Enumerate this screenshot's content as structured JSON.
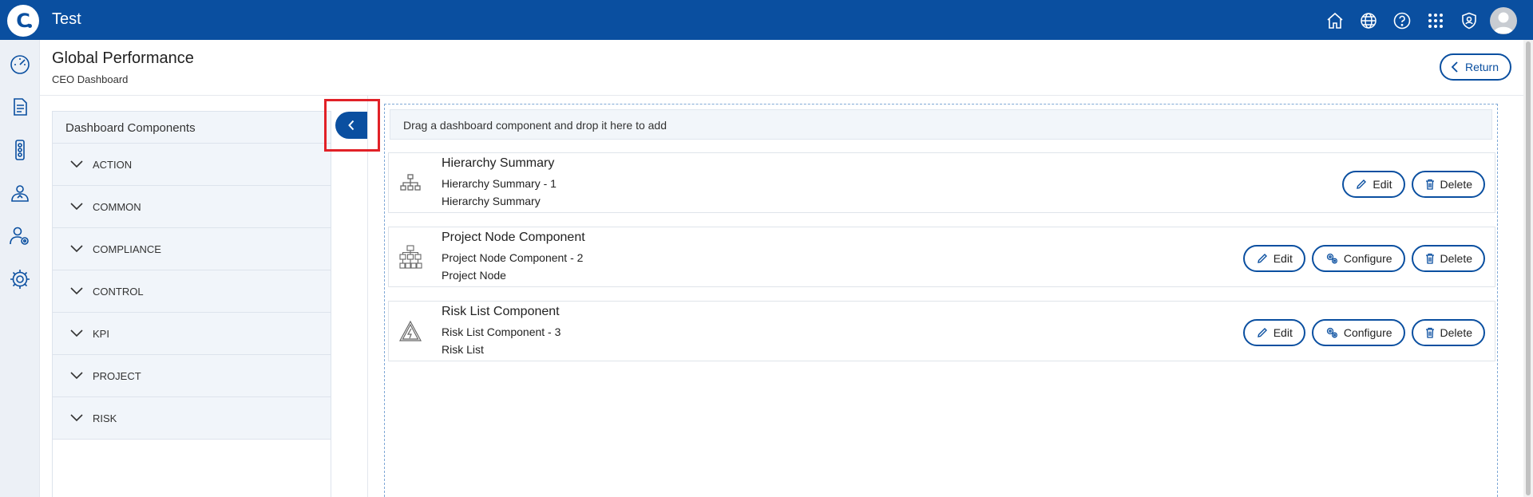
{
  "app": {
    "logo_letter": "C",
    "title": "Test"
  },
  "topbar_icons": [
    "home-icon",
    "globe-icon",
    "help-icon",
    "apps-grid-icon",
    "shield-icon",
    "user-avatar"
  ],
  "leftnav_icons": [
    "dashboard-gauge-icon",
    "document-icon",
    "traffic-light-icon",
    "risk-shield-icon",
    "user-settings-icon",
    "gear-icon"
  ],
  "page": {
    "title": "Global Performance",
    "subtitle": "CEO Dashboard",
    "return_label": "Return"
  },
  "components_panel": {
    "heading": "Dashboard Components",
    "categories": [
      "ACTION",
      "COMMON",
      "COMPLIANCE",
      "CONTROL",
      "KPI",
      "PROJECT",
      "RISK"
    ]
  },
  "dropzone": {
    "hint": "Drag a dashboard component and drop it here to add"
  },
  "cards": [
    {
      "title": "Hierarchy Summary",
      "line1": "Hierarchy Summary - 1",
      "line2": "Hierarchy Summary",
      "icon": "hierarchy-icon",
      "actions": [
        "Edit",
        "Delete"
      ]
    },
    {
      "title": "Project Node Component",
      "line1": "Project Node Component - 2",
      "line2": "Project Node",
      "icon": "project-node-icon",
      "actions": [
        "Edit",
        "Configure",
        "Delete"
      ]
    },
    {
      "title": "Risk List Component",
      "line1": "Risk List Component - 3",
      "line2": "Risk List",
      "icon": "risk-warning-icon",
      "actions": [
        "Edit",
        "Configure",
        "Delete"
      ]
    }
  ],
  "colors": {
    "brand": "#0a4fa0",
    "highlight": "#e12127",
    "panel_bg": "#f1f5fa"
  }
}
